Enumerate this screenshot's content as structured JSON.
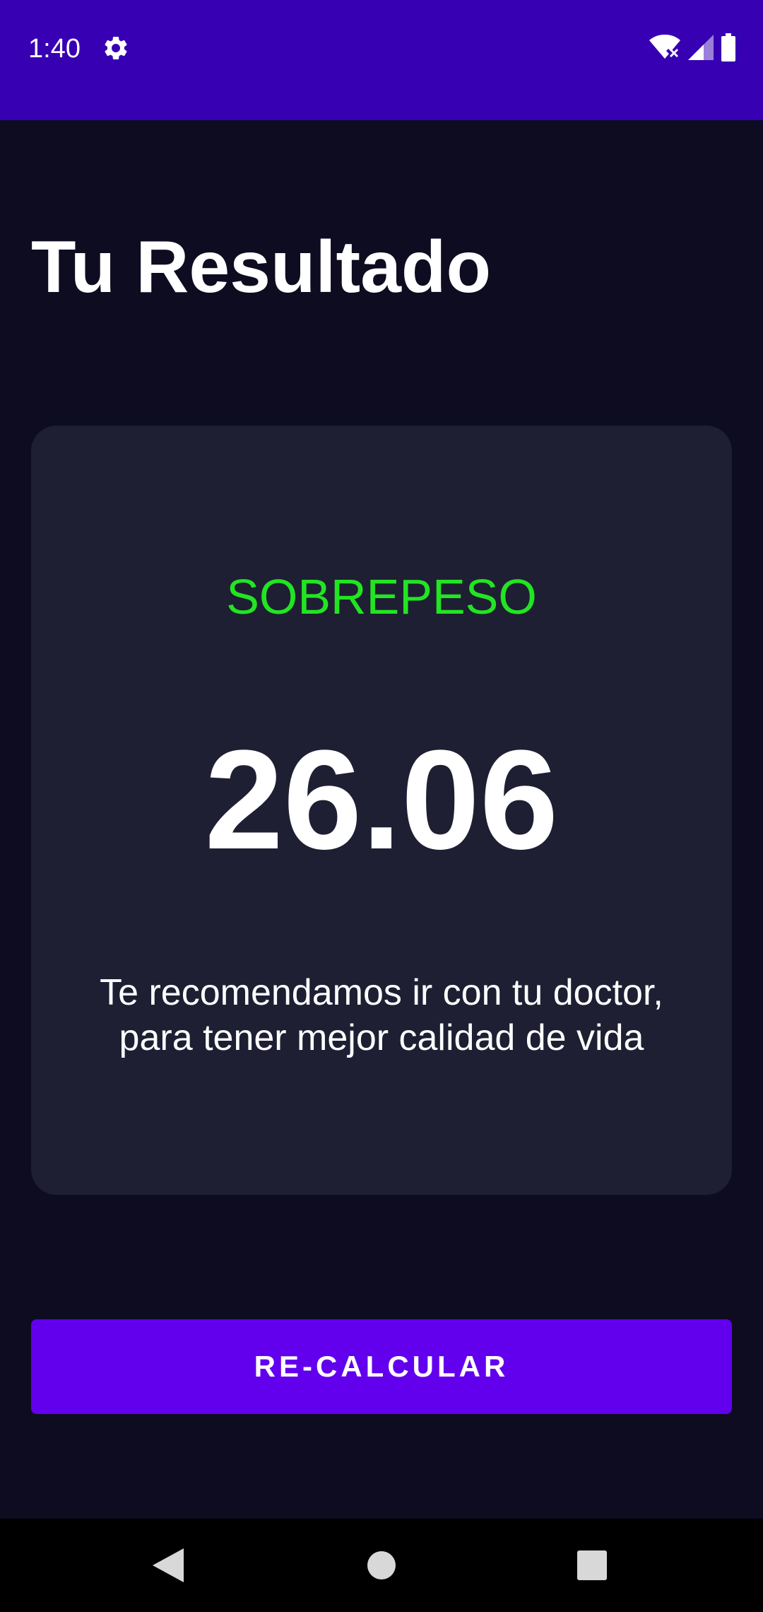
{
  "status_bar": {
    "time": "1:40",
    "settings_icon": "gear-icon",
    "wifi_icon": "wifi-icon",
    "signal_icon": "signal-icon",
    "battery_icon": "battery-icon",
    "background_color": "#3700B3"
  },
  "header": {
    "title": "Tu Resultado"
  },
  "result": {
    "status": "SOBREPESO",
    "status_color": "#22E522",
    "value": "26.06",
    "message": "Te recomendamos ir con tu doctor, para tener mejor calidad de vida"
  },
  "actions": {
    "recalculate_label": "RE-CALCULAR",
    "button_color": "#6200EE"
  },
  "nav_bar": {
    "back_icon": "back-icon",
    "home_icon": "home-icon",
    "recents_icon": "recents-icon"
  }
}
